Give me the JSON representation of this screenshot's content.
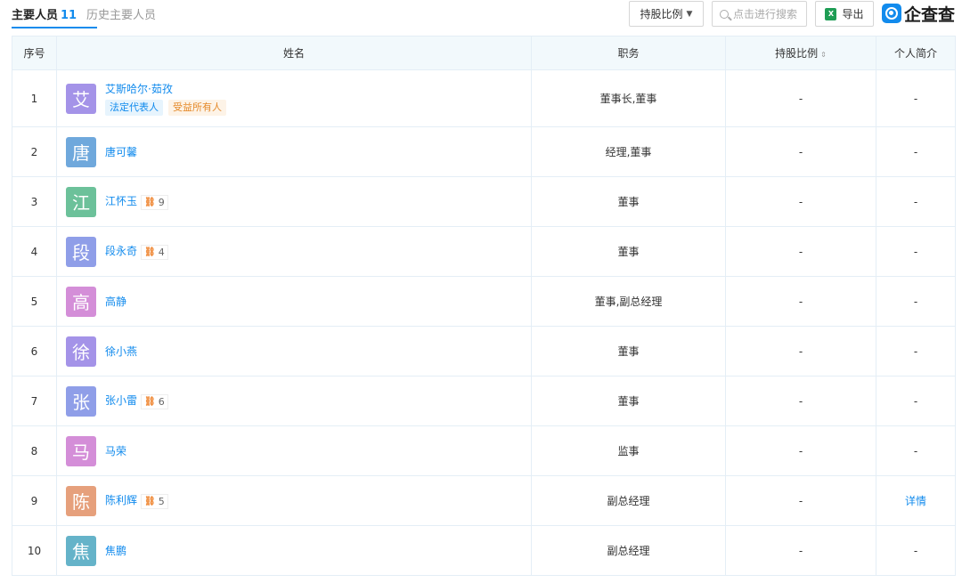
{
  "tabs": {
    "main_label": "主要人员",
    "main_count": "11",
    "history_label": "历史主要人员"
  },
  "toolbar": {
    "hold_label": "持股比例",
    "search_placeholder": "点击进行搜索",
    "export_label": "导出",
    "excel_icon_text": "X"
  },
  "logo": {
    "text": "企查查"
  },
  "table": {
    "headers": {
      "index": "序号",
      "name": "姓名",
      "position": "职务",
      "holding": "持股比例",
      "profile": "个人简介"
    },
    "rows": [
      {
        "index": "1",
        "avatar": "艾",
        "color": "#a493e8",
        "name": "艾斯哈尔·茹孜",
        "tags": [
          "法定代表人",
          "受益所有人"
        ],
        "rel": "",
        "position": "董事长,董事",
        "holding": "-",
        "profile": "-"
      },
      {
        "index": "2",
        "avatar": "唐",
        "color": "#6fa8dc",
        "name": "唐可馨",
        "tags": [],
        "rel": "",
        "position": "经理,董事",
        "holding": "-",
        "profile": "-"
      },
      {
        "index": "3",
        "avatar": "江",
        "color": "#6cc19a",
        "name": "江怀玉",
        "tags": [],
        "rel": "9",
        "position": "董事",
        "holding": "-",
        "profile": "-"
      },
      {
        "index": "4",
        "avatar": "段",
        "color": "#8f9ee8",
        "name": "段永奇",
        "tags": [],
        "rel": "4",
        "position": "董事",
        "holding": "-",
        "profile": "-"
      },
      {
        "index": "5",
        "avatar": "高",
        "color": "#d48ed8",
        "name": "高静",
        "tags": [],
        "rel": "",
        "position": "董事,副总经理",
        "holding": "-",
        "profile": "-"
      },
      {
        "index": "6",
        "avatar": "徐",
        "color": "#a493e8",
        "name": "徐小燕",
        "tags": [],
        "rel": "",
        "position": "董事",
        "holding": "-",
        "profile": "-"
      },
      {
        "index": "7",
        "avatar": "张",
        "color": "#8f9ee8",
        "name": "张小雷",
        "tags": [],
        "rel": "6",
        "position": "董事",
        "holding": "-",
        "profile": "-"
      },
      {
        "index": "8",
        "avatar": "马",
        "color": "#d48ed8",
        "name": "马荣",
        "tags": [],
        "rel": "",
        "position": "监事",
        "holding": "-",
        "profile": "-"
      },
      {
        "index": "9",
        "avatar": "陈",
        "color": "#e6a07c",
        "name": "陈利辉",
        "tags": [],
        "rel": "5",
        "position": "副总经理",
        "holding": "-",
        "profile": "详情"
      },
      {
        "index": "10",
        "avatar": "焦",
        "color": "#65b3c9",
        "name": "焦鹏",
        "tags": [],
        "rel": "",
        "position": "副总经理",
        "holding": "-",
        "profile": "-"
      }
    ]
  }
}
